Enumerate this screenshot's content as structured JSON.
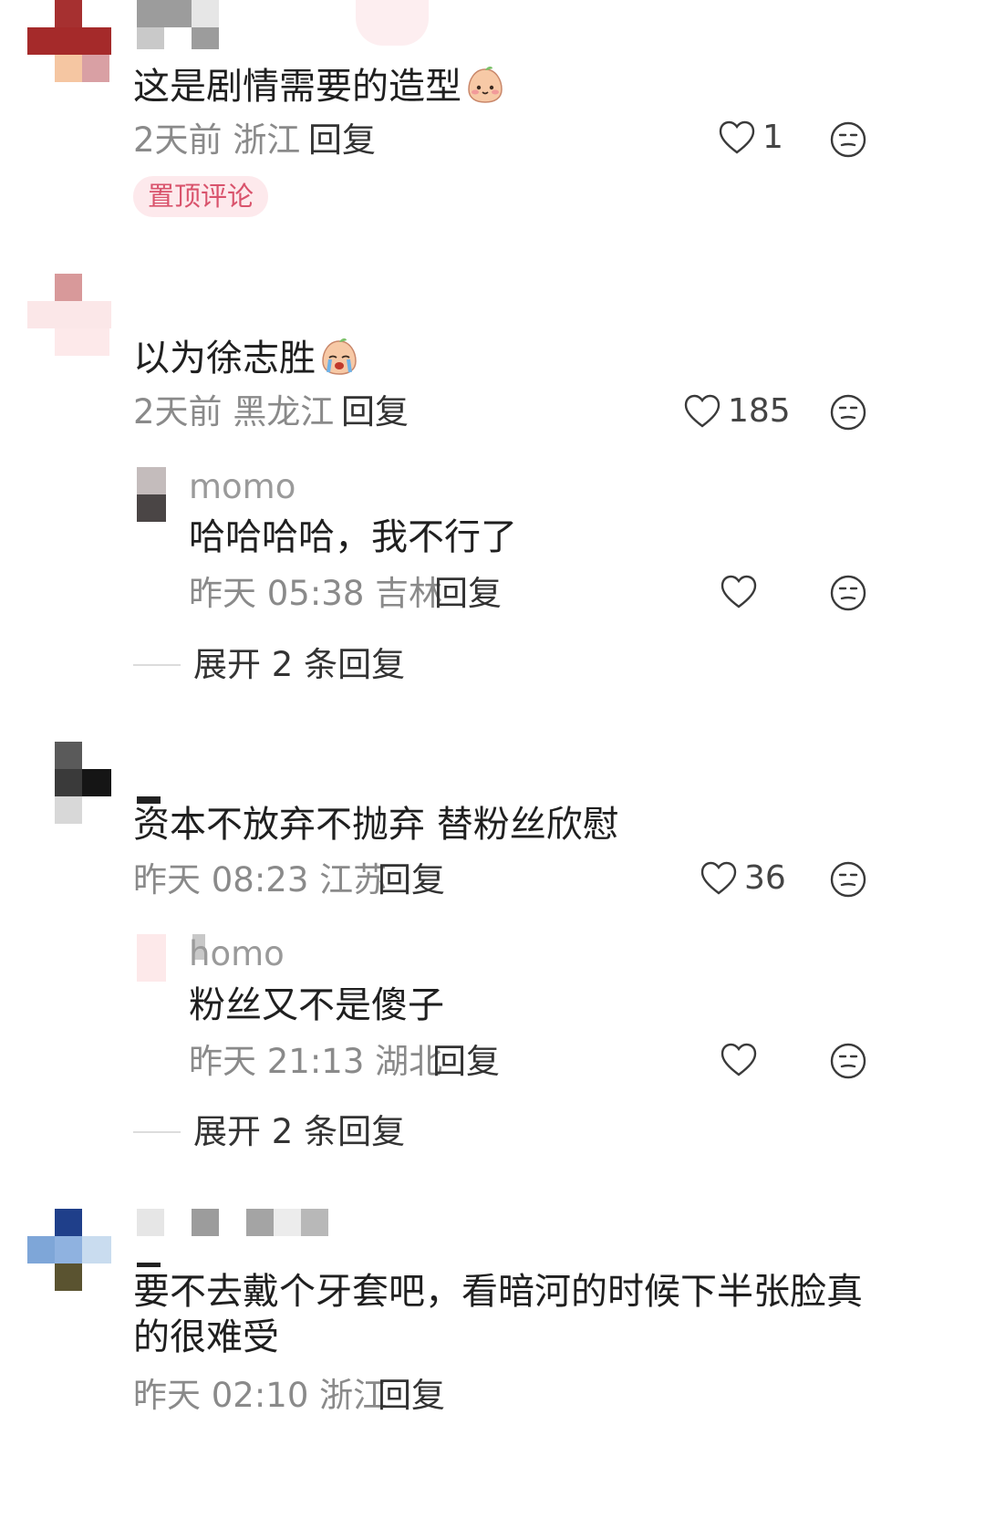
{
  "comments": [
    {
      "text": "这是剧情需要的造型",
      "emoji": "blush-peach-emoji",
      "time": "2天前",
      "location": "浙江",
      "reply_label": "回复",
      "likes": "1",
      "badge": "置顶评论"
    },
    {
      "text": "以为徐志胜",
      "emoji": "crying-peach-emoji",
      "time": "2天前",
      "location": "黑龙江",
      "reply_label": "回复",
      "likes": "185",
      "reply": {
        "username": "momo",
        "text": "哈哈哈哈，我不行了",
        "time": "昨天 05:38",
        "location": "吉林",
        "reply_label": "回复"
      },
      "expand_label": "展开 2 条回复"
    },
    {
      "text": "资本不放弃不抛弃 替粉丝欣慰",
      "time": "昨天 08:23",
      "location": "江苏",
      "reply_label": "回复",
      "likes": "36",
      "reply": {
        "username": "homo",
        "text": "粉丝又不是傻子",
        "time": "昨天 21:13",
        "location": "湖北",
        "reply_label": "回复"
      },
      "expand_label": "展开 2 条回复"
    },
    {
      "text_line1": "要不去戴个牙套吧，看暗河的时候下半张脸真",
      "text_line2": "的很难受",
      "time": "昨天 02:10",
      "location": "浙江",
      "reply_label": "回复"
    }
  ],
  "colors": {
    "pin_badge_bg": "#fde9ec",
    "pin_badge_text": "#d9536c",
    "meta_gray": "#8a8a8a"
  }
}
